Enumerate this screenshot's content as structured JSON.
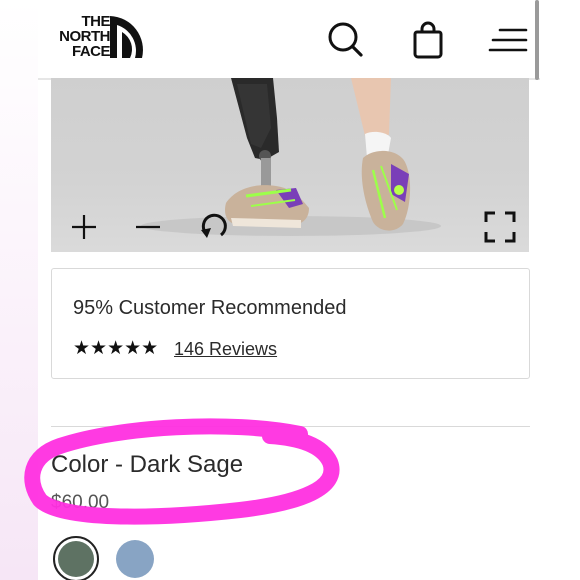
{
  "header": {
    "logo": {
      "line1": "THE",
      "line2": "NORTH",
      "line3": "FACE"
    },
    "icons": {
      "search": "search-icon",
      "bag": "shopping-bag-icon",
      "menu": "menu-icon"
    }
  },
  "viewer": {
    "controls": {
      "zoom_in": "plus-icon",
      "zoom_out": "minus-icon",
      "rotate": "rotate-icon",
      "fullscreen": "fullscreen-icon"
    }
  },
  "rating": {
    "recommend_text": "95% Customer Recommended",
    "stars": "★★★★★",
    "star_value": 5,
    "reviews_link": "146 Reviews"
  },
  "product": {
    "color_label": "Color - Dark Sage",
    "price": "$60.00",
    "swatches": [
      {
        "name": "Dark Sage",
        "color": "#5e7263",
        "selected": true
      },
      {
        "name": "Blue",
        "color": "#88a4c4",
        "selected": false
      }
    ]
  },
  "colors": {
    "annotation_marker": "#ff2fe0",
    "text_primary": "#2b2b2b"
  }
}
